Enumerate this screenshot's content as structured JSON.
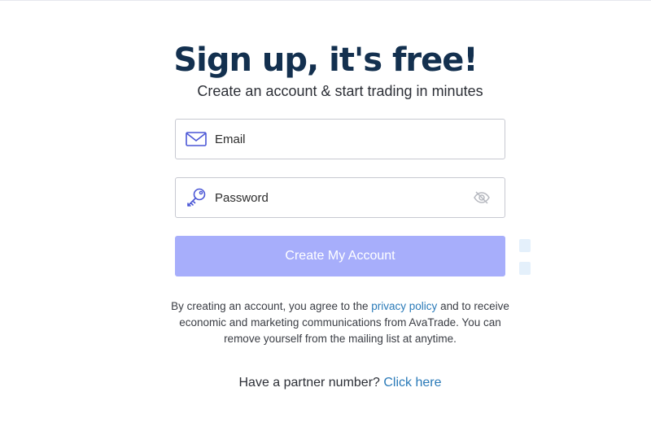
{
  "signup": {
    "title": "Sign up, it's free!",
    "subtitle": "Create an account & start trading in minutes",
    "email": {
      "placeholder": "Email",
      "value": "",
      "icon": "envelope-icon"
    },
    "password": {
      "placeholder": "Password",
      "value": "",
      "icon": "key-icon",
      "toggle_icon": "eye-hidden-icon"
    },
    "submit_label": "Create My Account",
    "legal": {
      "prefix": "By creating an account, you agree to the ",
      "privacy_link": "privacy policy",
      "suffix": " and to receive economic and marketing communications from AvaTrade. You can remove yourself from the mailing list at anytime."
    },
    "partner": {
      "prompt": "Have a partner number? ",
      "link": "Click here"
    }
  },
  "colors": {
    "heading": "#13304f",
    "button_bg": "#a7aefb",
    "button_text": "#ffffff",
    "link": "#2a7ab8",
    "input_border": "#c7c9d1",
    "icon": "#4b57d6"
  }
}
